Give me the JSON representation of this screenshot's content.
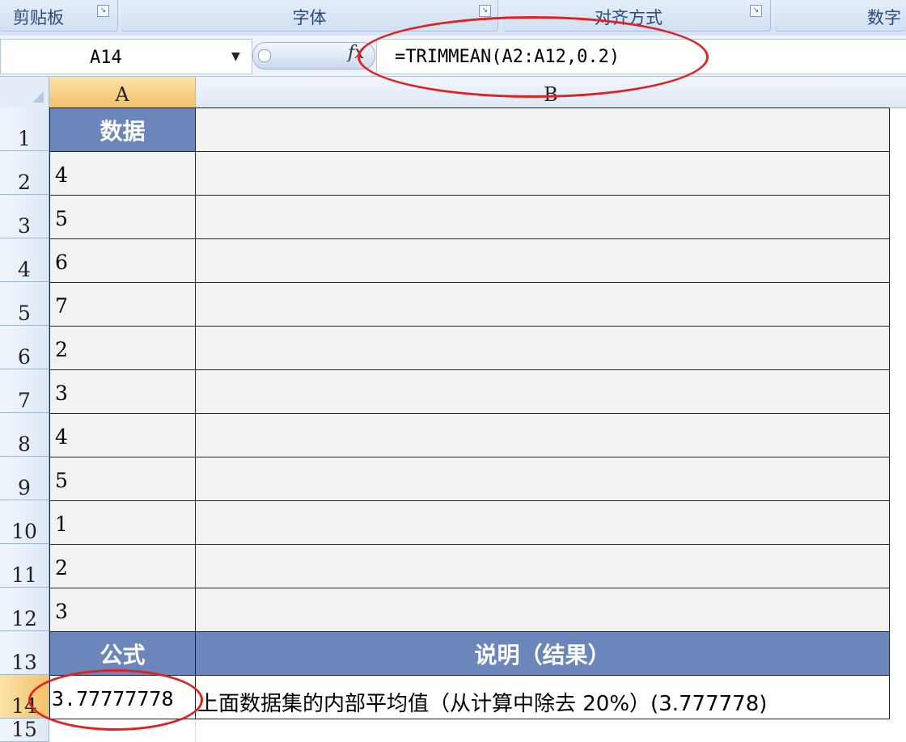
{
  "ribbon": {
    "groups": [
      {
        "label": "剪贴板"
      },
      {
        "label": "字体"
      },
      {
        "label": "对齐方式"
      },
      {
        "label": "数字"
      }
    ]
  },
  "formula_bar": {
    "name_box": "A14",
    "fx_label": "fx",
    "formula": "=TRIMMEAN(A2:A12,0.2)"
  },
  "columns": [
    "A",
    "B"
  ],
  "rows": [
    "1",
    "2",
    "3",
    "4",
    "5",
    "6",
    "7",
    "8",
    "9",
    "10",
    "11",
    "12",
    "13",
    "14",
    "15"
  ],
  "table": {
    "header_data": "数据",
    "values": [
      "4",
      "5",
      "6",
      "7",
      "2",
      "3",
      "4",
      "5",
      "1",
      "2",
      "3"
    ],
    "header_formula": "公式",
    "header_desc": "说明（结果）",
    "result": "3.77777778",
    "description": "上面数据集的内部平均值（从计算中除去 20%）(3.777778)"
  },
  "colors": {
    "header_fill": "#6a86ba",
    "highlight_ellipse": "#e0211f"
  }
}
